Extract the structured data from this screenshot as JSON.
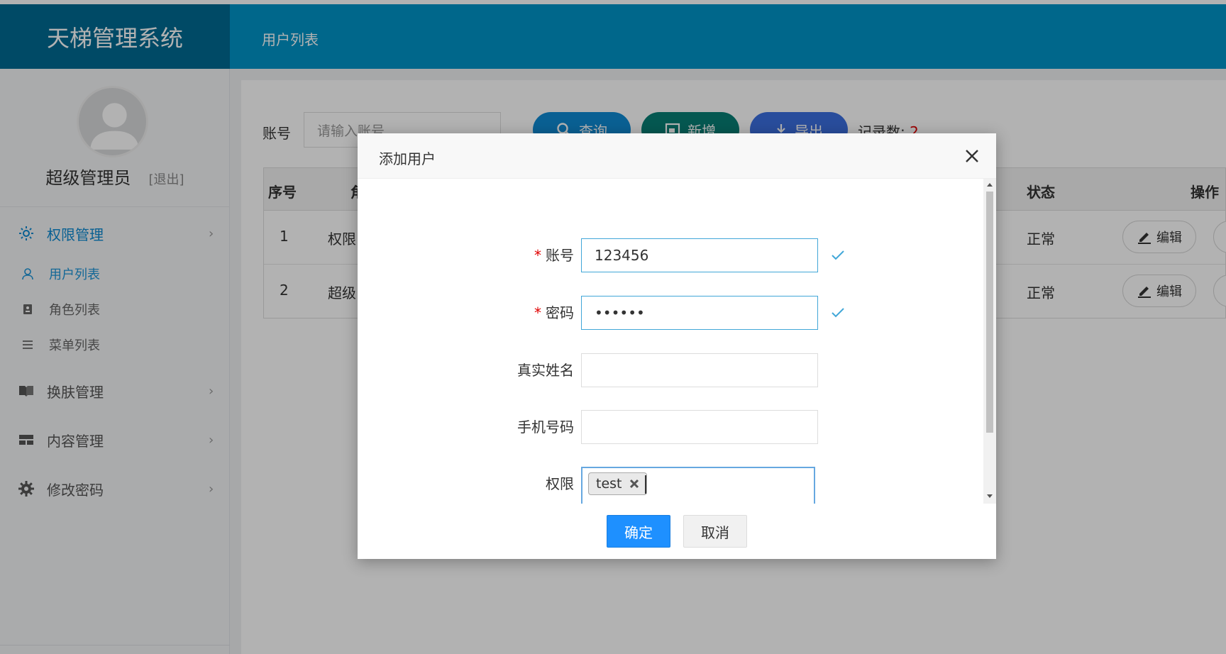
{
  "app": {
    "brand": "天梯管理系统",
    "header_title": "用户列表"
  },
  "sidebar": {
    "user_name": "超级管理员",
    "logout": "[退出]",
    "menus": [
      {
        "label": "权限管理",
        "icon": "gear-icon",
        "arrow": "›"
      },
      {
        "label": "换肤管理",
        "icon": "book-icon",
        "arrow": "›"
      },
      {
        "label": "内容管理",
        "icon": "layout-icon",
        "arrow": "›"
      },
      {
        "label": "修改密码",
        "icon": "cog-icon",
        "arrow": "›"
      }
    ],
    "sub_items": [
      {
        "label": "用户列表",
        "icon": "user-icon"
      },
      {
        "label": "角色列表",
        "icon": "id-card-icon"
      },
      {
        "label": "菜单列表",
        "icon": "list-icon"
      }
    ]
  },
  "filter": {
    "account_label": "账号",
    "account_placeholder": "请输入账号",
    "query_label": "查询",
    "add_label": "新增",
    "export_label": "导出",
    "record_label": "记录数:",
    "record_count": "2"
  },
  "table": {
    "headers": {
      "index": "序号",
      "role": "角",
      "status": "状态",
      "actions": "操作"
    },
    "rows": [
      {
        "index": "1",
        "role": "权限",
        "status": "正常",
        "edit": "编辑"
      },
      {
        "index": "2",
        "role": "超级",
        "status": "正常",
        "edit": "编辑"
      }
    ]
  },
  "modal": {
    "title": "添加用户",
    "fields": {
      "account": {
        "label": "账号",
        "required": "*",
        "value": "123456"
      },
      "password": {
        "label": "密码",
        "required": "*",
        "value": "••••••"
      },
      "real_name": {
        "label": "真实姓名",
        "value": ""
      },
      "phone": {
        "label": "手机号码",
        "value": ""
      },
      "permission": {
        "label": "权限",
        "tags": [
          "test"
        ]
      }
    },
    "ok_label": "确定",
    "cancel_label": "取消"
  },
  "colors": {
    "brand_bg": "#006a93",
    "header_bg": "#0094c8",
    "primary": "#1e90ff",
    "required": "#e00000",
    "valid": "#41a7d8"
  }
}
